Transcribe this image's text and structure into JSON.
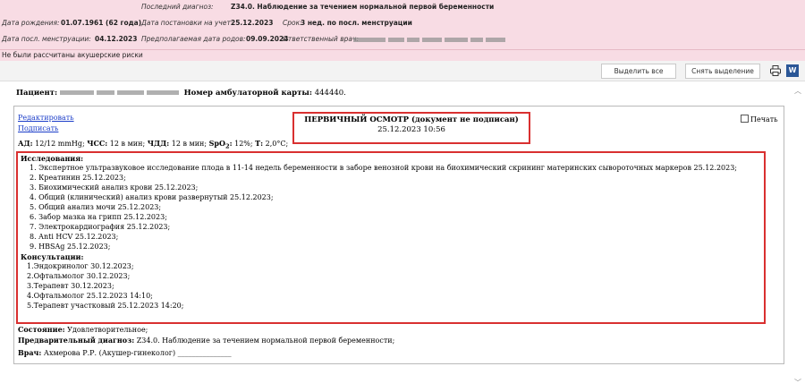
{
  "header": {
    "diagnosis_label": "Последний диагноз:",
    "diagnosis_value": "Z34.0. Наблюдение за течением нормальной первой беременности",
    "birth_label": "Дата рождения:",
    "birth_value": "01.07.1961 (62 года)",
    "registered_label": "Дата постановки на учет:",
    "registered_value": "25.12.2023",
    "term_label": "Срок:",
    "term_value": "3 нед. по посл. менструации",
    "last_menses_label": "Дата посл. менструации:",
    "last_menses_value": "04.12.2023",
    "due_label": "Предполагаемая дата родов:",
    "due_value": "09.09.2024",
    "doctor_label": "Ответственный врач:",
    "risk_text": "Не были рассчитаны акушерские риски"
  },
  "toolbar": {
    "select_all": "Выделить все",
    "deselect": "Снять выделение",
    "word_icon_letter": "W"
  },
  "patient": {
    "label": "Пациент:",
    "card_label": "Номер амбулаторной карты:",
    "card_value": "444440."
  },
  "doc": {
    "edit_link": "Редактировать",
    "sign_link": "Подписать",
    "title": "ПЕРВИЧНЫЙ ОСМОТР (документ не подписан)",
    "datetime": "25.12.2023 10:56",
    "print_label": "Печать",
    "vitals": {
      "ad_label": "АД:",
      "ad_value": "12/12 mmHg;",
      "hr_label": "ЧСС:",
      "hr_value": "12 в мин;",
      "rr_label": "ЧДД:",
      "rr_value": "12 в мин;",
      "spo2_label": "SpO",
      "spo2_sub": "2",
      "spo2_colon": ":",
      "spo2_value": "12%;",
      "t_label": "Т:",
      "t_value": "2,0°C;"
    },
    "research_header": "Исследования:",
    "research": [
      "1. Экспертное ультразвуковое исследование плода в 11-14 недель беременности в заборе венозной крови на биохимический скрининг материнских сывороточных маркеров 25.12.2023;",
      "2. Креатинин 25.12.2023;",
      "3. Биохимический анализ крови 25.12.2023;",
      "4. Общий (клинический) анализ крови развернутый 25.12.2023;",
      "5. Общий анализ мочи 25.12.2023;",
      "6. Забор мазка на грипп 25.12.2023;",
      "7. Электрокардиография 25.12.2023;",
      "8. Anti HCV 25.12.2023;",
      "9. HBSAg 25.12.2023;"
    ],
    "consult_header": "Консультации:",
    "consults": [
      "1.Эндокринолог 30.12.2023;",
      "2.Офтальмолог 30.12.2023;",
      "3.Терапевт 30.12.2023;",
      "4.Офтальмолог 25.12.2023 14:10;",
      "5.Терапевт участковый 25.12.2023 14:20;"
    ],
    "state_label": "Состояние:",
    "state_value": "Удовлетворительное;",
    "prelim_label": "Предварительный диагноз:",
    "prelim_value": "Z34.0. Наблюдение за течением нормальной первой беременности;",
    "doctor_label": "Врач:",
    "doctor_value": "Ахмерова Р.Р. (Акушер-гинеколог) _______________"
  }
}
